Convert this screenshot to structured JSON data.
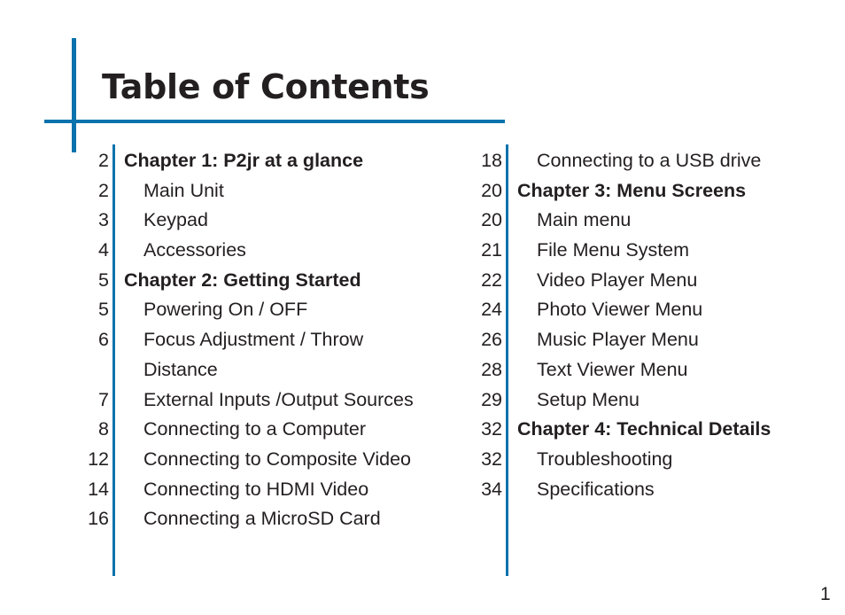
{
  "page": {
    "title": "Table of Contents",
    "page_number": "1",
    "accent_color": "#0a72ac",
    "text_color": "#231f20"
  },
  "toc": {
    "columns": [
      {
        "entries": [
          {
            "page": "2",
            "label": "Chapter 1: P2jr at a glance",
            "type": "chapter"
          },
          {
            "page": "2",
            "label": "Main Unit",
            "type": "sub"
          },
          {
            "page": "3",
            "label": "Keypad",
            "type": "sub"
          },
          {
            "page": "4",
            "label": "Accessories",
            "type": "sub"
          },
          {
            "page": "5",
            "label": "Chapter 2: Getting Started",
            "type": "chapter"
          },
          {
            "page": "5",
            "label": "Powering On / OFF",
            "type": "sub"
          },
          {
            "page": "6",
            "label": "Focus Adjustment / Throw",
            "type": "sub"
          },
          {
            "page": "",
            "label": "Distance",
            "type": "sub"
          },
          {
            "page": "7",
            "label": "External Inputs /Output Sources",
            "type": "sub"
          },
          {
            "page": "8",
            "label": "Connecting to a Computer",
            "type": "sub"
          },
          {
            "page": "12",
            "label": "Connecting to Composite Video",
            "type": "sub"
          },
          {
            "page": "14",
            "label": "Connecting to HDMI Video",
            "type": "sub"
          },
          {
            "page": "16",
            "label": "Connecting a MicroSD Card",
            "type": "sub"
          }
        ]
      },
      {
        "entries": [
          {
            "page": "18",
            "label": "Connecting to a USB drive",
            "type": "sub"
          },
          {
            "page": "20",
            "label": "Chapter 3: Menu Screens",
            "type": "chapter"
          },
          {
            "page": "20",
            "label": "Main menu",
            "type": "sub"
          },
          {
            "page": "21",
            "label": "File Menu System",
            "type": "sub"
          },
          {
            "page": "22",
            "label": "Video Player Menu",
            "type": "sub"
          },
          {
            "page": "24",
            "label": "Photo Viewer Menu",
            "type": "sub"
          },
          {
            "page": "26",
            "label": "Music Player Menu",
            "type": "sub"
          },
          {
            "page": "28",
            "label": "Text Viewer Menu",
            "type": "sub"
          },
          {
            "page": "29",
            "label": "Setup Menu",
            "type": "sub"
          },
          {
            "page": "32",
            "label": "Chapter 4: Technical Details",
            "type": "chapter"
          },
          {
            "page": "32",
            "label": "Troubleshooting",
            "type": "sub"
          },
          {
            "page": "34",
            "label": "Specifications",
            "type": "sub"
          }
        ]
      }
    ]
  }
}
